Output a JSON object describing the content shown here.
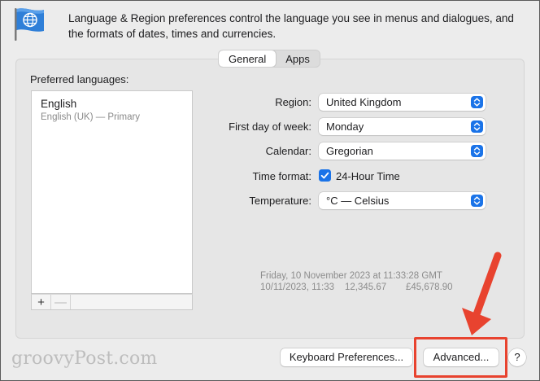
{
  "header": {
    "description": "Language & Region preferences control the language you see in menus and dialogues, and the formats of dates, times and currencies."
  },
  "tabs": [
    {
      "label": "General",
      "active": true
    },
    {
      "label": "Apps",
      "active": false
    }
  ],
  "languages": {
    "section_label": "Preferred languages:",
    "items": [
      {
        "name": "English",
        "detail": "English (UK) — Primary"
      }
    ],
    "add_label": "+",
    "remove_label": "—"
  },
  "form": {
    "region": {
      "label": "Region:",
      "value": "United Kingdom"
    },
    "first_day": {
      "label": "First day of week:",
      "value": "Monday"
    },
    "calendar": {
      "label": "Calendar:",
      "value": "Gregorian"
    },
    "time_format": {
      "label": "Time format:",
      "checkbox_label": "24-Hour Time",
      "checked": true
    },
    "temperature": {
      "label": "Temperature:",
      "value": "°C — Celsius"
    }
  },
  "sample": {
    "date_long": "Friday, 10 November 2023 at 11:33:28 GMT",
    "date_short": "10/11/2023, 11:33",
    "number": "12,345.67",
    "currency": "£45,678.90"
  },
  "buttons": {
    "keyboard": "Keyboard Preferences...",
    "advanced": "Advanced...",
    "help": "?"
  },
  "watermark": "groovyPost.com",
  "colors": {
    "accent": "#1a73e8",
    "highlight": "#e8432f",
    "window_bg": "#ececec"
  },
  "icons": {
    "flag": "globe-flag-icon",
    "popup": "chevron-up-down-icon",
    "check": "checkmark-icon",
    "arrow": "red-arrow-icon"
  }
}
